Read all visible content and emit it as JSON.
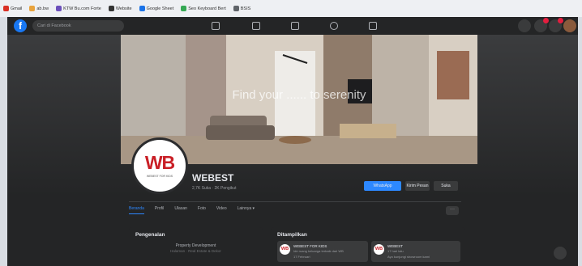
{
  "bookmarks": [
    {
      "label": "Gmail",
      "color": "#d93025"
    },
    {
      "label": "ab.bw",
      "color": "#e8a33d"
    },
    {
      "label": "KTW Bu.com Forte",
      "color": "#6b4fbb"
    },
    {
      "label": "Website",
      "color": "#333333"
    },
    {
      "label": "Google Sheet",
      "color": "#1a73e8"
    },
    {
      "label": "Seo Keyboard Bert",
      "color": "#34a853"
    },
    {
      "label": "BSIS",
      "color": "#5f6368"
    }
  ],
  "header": {
    "logo_letter": "f",
    "search_placeholder": "Cari di Facebook",
    "nav": [
      "home-icon",
      "watch-icon",
      "marketplace-icon",
      "groups-icon",
      "gaming-icon"
    ],
    "right_icons": [
      "menu-icon",
      "messenger-icon",
      "notifications-icon",
      "account-avatar"
    ]
  },
  "cover": {
    "overlay_text": "Find your ...... to serenity"
  },
  "page": {
    "logo_text": "WB",
    "logo_subtext": "WEBEST FOR KIDS",
    "name": "WEBEST",
    "meta": "2,7K Suka · 2K Pengikut"
  },
  "actions": [
    {
      "label": "WhatsApp",
      "primary": true
    },
    {
      "label": "Kirim Pesan",
      "primary": false
    },
    {
      "label": "Suka",
      "primary": false
    }
  ],
  "tabs": [
    "Beranda",
    "Profil",
    "Ulasan",
    "Foto",
    "Video",
    "Lainnya ▾"
  ],
  "active_tab": "Beranda",
  "more_button": "···",
  "intro": {
    "title": "Pengenalan",
    "category": "Property Development",
    "footer": "Halaman · Real Estate & Dekor"
  },
  "featured": {
    "title": "Ditampilkan",
    "posts": [
      {
        "avatar": "WB",
        "author": "WEBEST FOR KIDS",
        "line2": "Ide ruang keluarga terbaik dari WB",
        "line3": "17 Februari"
      },
      {
        "avatar": "WB",
        "author": "WEBEST",
        "line2": "17 hari lalu",
        "line3": "Ayo kunjungi showroom kami"
      }
    ]
  },
  "colors": {
    "fb_blue": "#1877f2",
    "action_blue": "#2d88ff",
    "brand_red": "#c91f26",
    "dark_bg": "#242526"
  }
}
